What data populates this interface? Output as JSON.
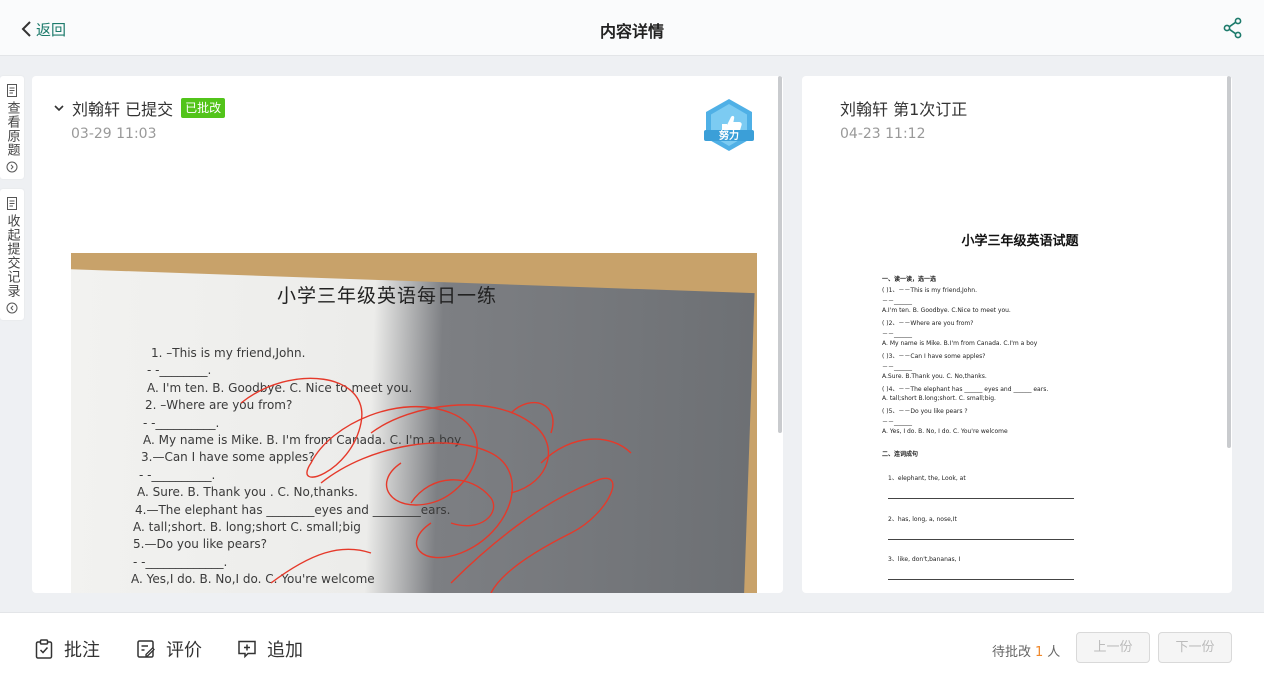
{
  "header": {
    "back_label": "返回",
    "title": "内容详情"
  },
  "rail": {
    "view_original": "查看原题",
    "collapse_records": "收起提交记录"
  },
  "submission": {
    "student_status": "刘翰轩 已提交",
    "badge": "已批改",
    "time": "03-29 11:03",
    "medal_label": "努力",
    "photo": {
      "title": "小学三年级英语每日一练",
      "lines": [
        "1.  –This is my friend,John.",
        "- -________.",
        "A. I'm ten.      B. Goodbye.        C. Nice to meet you.",
        "2. –Where are you from?",
        "- -__________.",
        "A. My name is Mike.     B. I'm from Canada.     C. I'm a boy",
        "3.—Can I have some apples?",
        "- -__________.",
        "A. Sure.         B. Thank you .        C. No,thanks.",
        "4.—The elephant has ________eyes and ________ears.",
        "A. tall;short.         B. long;short      C. small;big",
        "5.—Do you like pears?",
        "- -_____________.",
        "A. Yes,I do.           B. No,I do.         C. You're welcome"
      ]
    }
  },
  "correction": {
    "student_round": "刘翰轩 第1次订正",
    "time": "04-23 11:12",
    "sheet": {
      "title": "小学三年级英语试题",
      "lines": [
        "一、读一读，选一选",
        "(  )1、－－This is my friend,John.",
        "－－______",
        "A.I'm ten.    B. Goodbye.   C.Nice to meet you.",
        "(  )2、－－Where are you from?",
        "－－______",
        "A. My name is Mike.   B.I'm from Canada.   C.I'm a boy",
        "(  )3、－－Can I have some apples?",
        "－－______",
        "A.Sure.    B.Thank you.   C. No,thanks.",
        "(  )4、－－The elephant has ______ eyes and ______ ears.",
        "A.  tall;short  B.long;short.  C. small;big.",
        "(  )5、－－Do you like pears ?",
        "－－______",
        "A. Yes, I do.   B. No, I do.   C. You're welcome",
        "二、连词成句",
        "1、elephant, the, Look, at",
        "2、has, long, a, nose,It",
        "3、like, don't,bananas, I"
      ]
    }
  },
  "footer": {
    "annotate": "批注",
    "evaluate": "评价",
    "append": "追加",
    "pending_prefix": "待批改",
    "pending_count": "1",
    "pending_suffix": "人",
    "prev": "上一份",
    "next": "下一份"
  },
  "colors": {
    "accent": "#1c7a6b",
    "badge_green": "#52c41a",
    "pending_orange": "#f0882a",
    "medal_blue": "#4fb0e6"
  }
}
